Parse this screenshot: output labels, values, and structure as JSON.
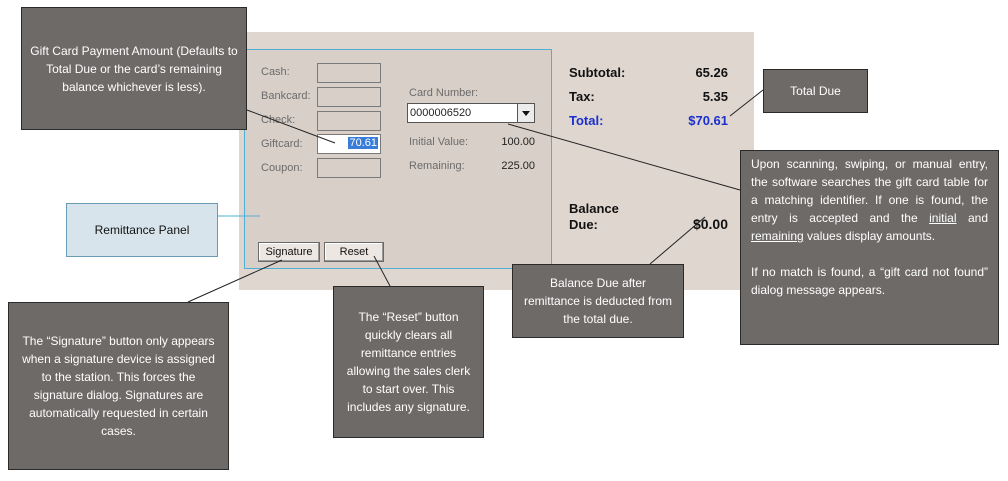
{
  "remittance": {
    "cash_label": "Cash:",
    "bankcard_label": "Bankcard:",
    "check_label": "Check:",
    "giftcard_label": "Giftcard:",
    "giftcard_value": "70.61",
    "coupon_label": "Coupon:",
    "card_number_label": "Card Number:",
    "card_number_value": "0000006520",
    "initial_value_label": "Initial Value:",
    "initial_value": "100.00",
    "remaining_label": "Remaining:",
    "remaining_value": "225.00",
    "signature_button": "Signature",
    "reset_button": "Reset"
  },
  "totals": {
    "subtotal_label": "Subtotal:",
    "subtotal_value": "65.26",
    "tax_label": "Tax:",
    "tax_value": "5.35",
    "total_label": "Total:",
    "total_value": "$70.61",
    "balance_label_1": "Balance",
    "balance_label_2": "Due:",
    "balance_value": "$0.00"
  },
  "callouts": {
    "gift_card_amount": "Gift Card Payment Amount (Defaults to Total Due or the card’s remaining balance whichever is less).",
    "total_due": "Total Due",
    "remittance_panel": "Remittance Panel",
    "gift_scan_1a": "Upon scanning, swiping, or manual entry, the software searches the gift card table for a matching identifier. If one is found, the entry is accepted and the ",
    "gift_scan_initial": "initial",
    "gift_scan_and": " and ",
    "gift_scan_remaining": "remaining",
    "gift_scan_1b": " values display amounts.",
    "gift_scan_2": "If no match is found, a “gift card not found” dialog message appears.",
    "balance_due": "Balance Due after remittance is deducted from the total due.",
    "signature": "The “Signature” button only appears when a signature device is assigned to the station. This forces the signature dialog. Signatures are automatically requested in certain cases.",
    "reset": "The “Reset” button quickly clears all remittance entries allowing the sales clerk to start over. This includes any signature."
  },
  "colors": {
    "panel_bg": "#e0d6d0",
    "callout_dark": "#6e6a68",
    "callout_light": "#d8e4ec",
    "total_blue": "#1a2fd0",
    "panel_border": "#4fb0d6"
  }
}
